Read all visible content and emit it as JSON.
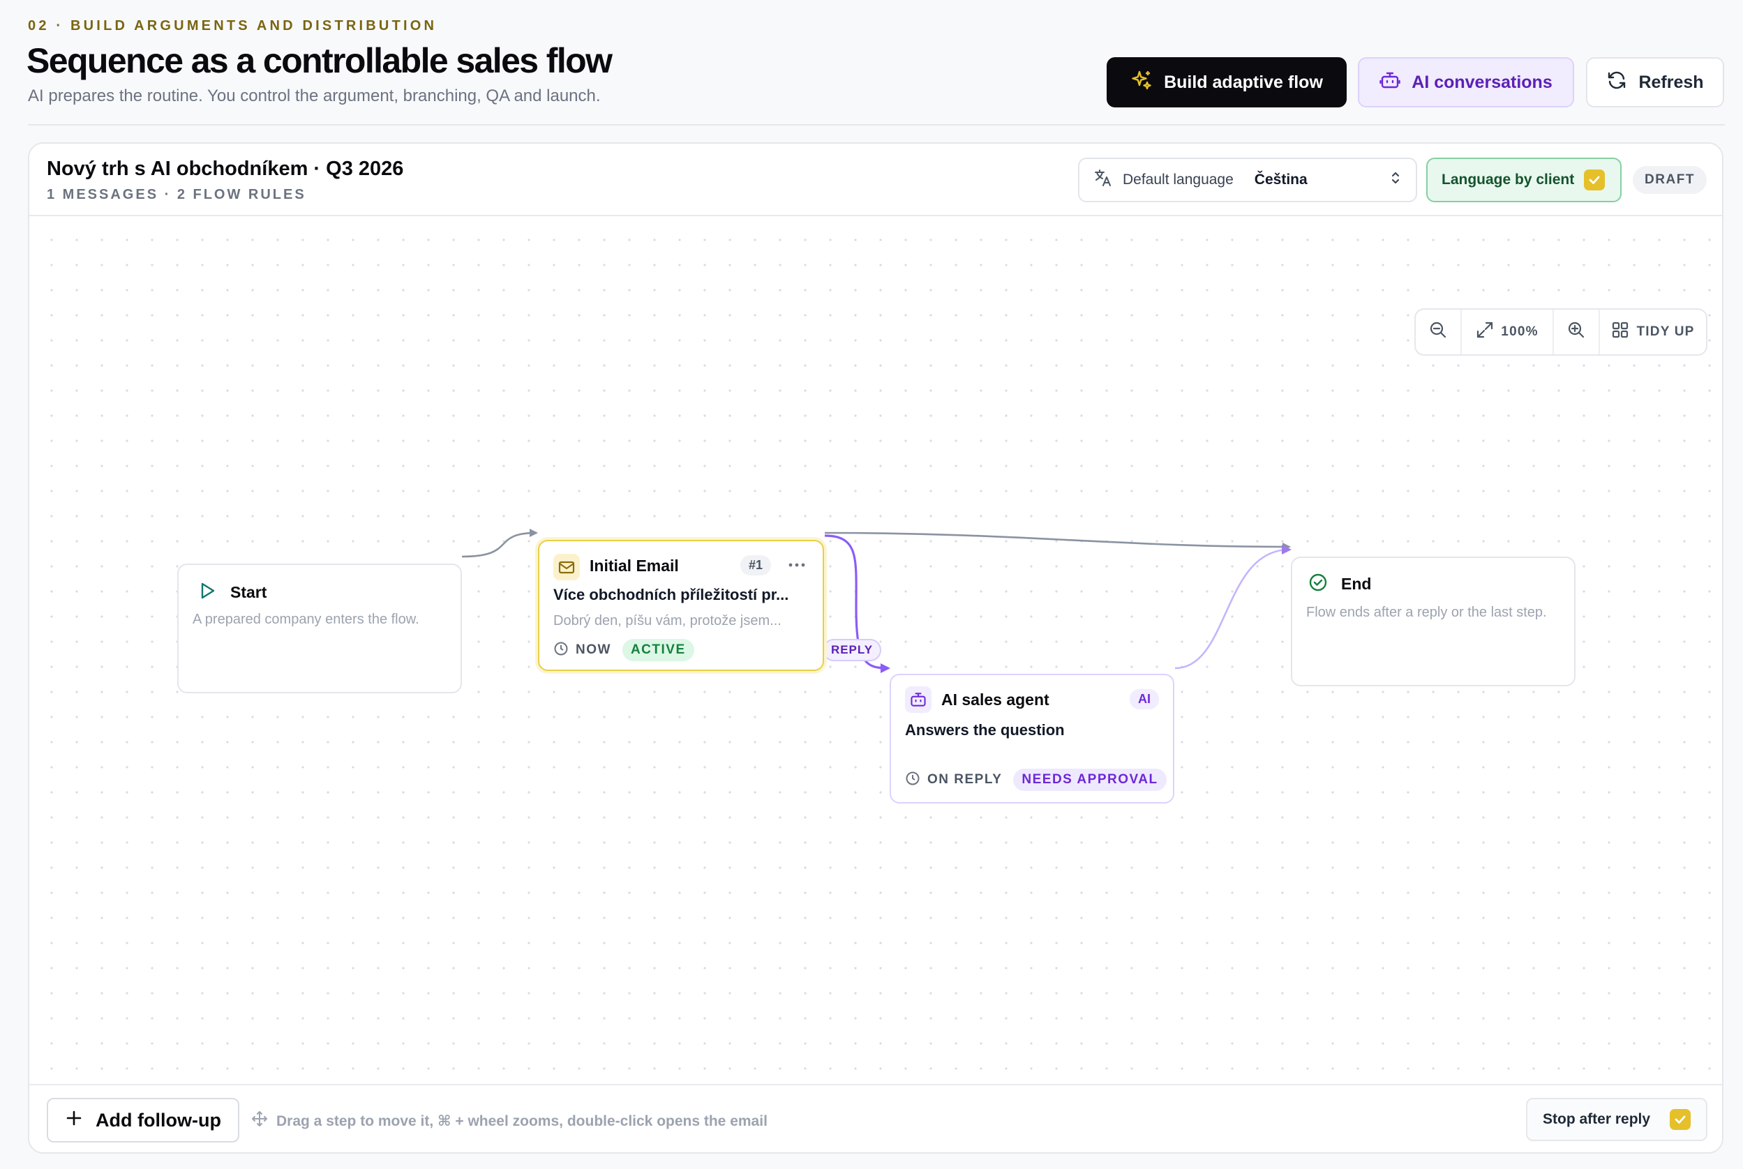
{
  "header": {
    "eyebrow": "02 · BUILD ARGUMENTS AND DISTRIBUTION",
    "title": "Sequence as a controllable sales flow",
    "subtitle": "AI prepares the routine. You control the argument, branching, QA and launch.",
    "build_label": "Build adaptive flow",
    "ai_conversations_label": "AI conversations",
    "refresh_label": "Refresh"
  },
  "flow": {
    "title": "Nový trh s AI obchodníkem · Q3 2026",
    "meta": "1 MESSAGES · 2 FLOW RULES",
    "default_language_label": "Default language",
    "default_language_value": "Čeština",
    "language_by_client_label": "Language by client",
    "language_by_client_checked": true,
    "status": "DRAFT"
  },
  "zoom": {
    "level": "100%",
    "tidy_label": "TIDY UP"
  },
  "nodes": {
    "start": {
      "title": "Start",
      "description": "A prepared company enters the flow."
    },
    "email": {
      "title": "Initial Email",
      "number": "#1",
      "subject": "Více obchodních příležitostí pr...",
      "preview": "Dobrý den, píšu vám, protože jsem...",
      "timing": "NOW",
      "status": "ACTIVE"
    },
    "agent": {
      "title": "AI sales agent",
      "badge": "AI",
      "body": "Answers the question",
      "timing": "ON REPLY",
      "status": "NEEDS APPROVAL"
    },
    "end": {
      "title": "End",
      "description": "Flow ends after a reply or the last step."
    }
  },
  "edges": {
    "reply_label": "REPLY"
  },
  "footer": {
    "add_label": "Add follow-up",
    "hint": "Drag a step to move it, ⌘ + wheel zooms, double-click opens the email",
    "stop_after_reply_label": "Stop after reply",
    "stop_after_reply_checked": true
  },
  "colors": {
    "accent_yellow": "#e5c02a",
    "accent_purple": "#8b5cf6",
    "success_green": "#15803d",
    "edge_gray": "#8a93a3"
  }
}
